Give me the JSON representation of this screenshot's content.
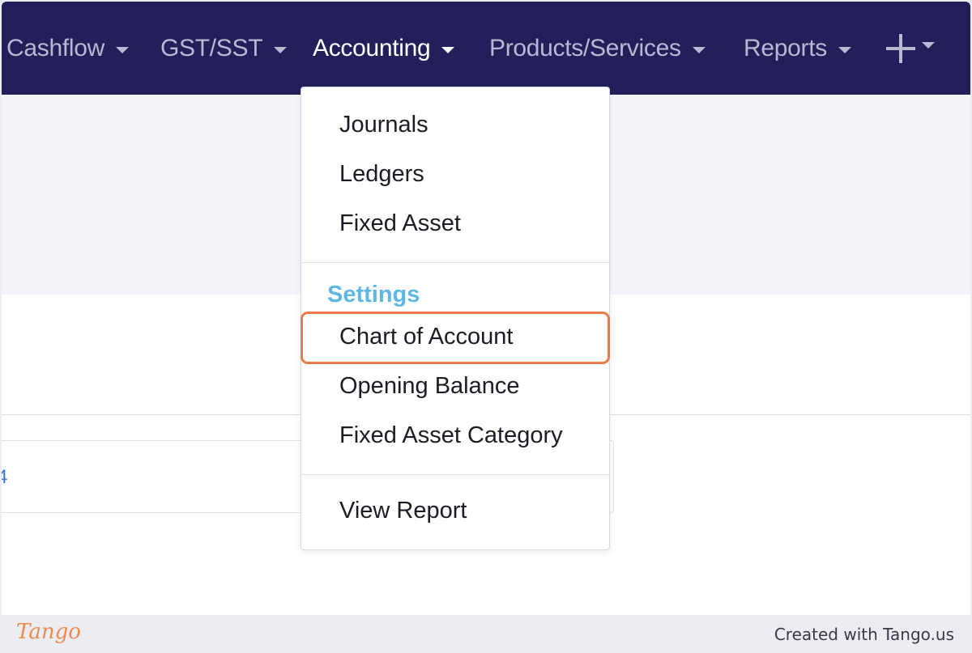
{
  "nav": {
    "items": [
      {
        "label": "Cashflow"
      },
      {
        "label": "GST/SST"
      },
      {
        "label": "Accounting"
      },
      {
        "label": "Products/Services"
      },
      {
        "label": "Reports"
      }
    ],
    "active": "Accounting"
  },
  "dropdown": {
    "group1": [
      "Journals",
      "Ledgers",
      "Fixed Asset"
    ],
    "settings_header": "Settings",
    "group2": [
      "Chart of Account",
      "Opening Balance",
      "Fixed Asset Category"
    ],
    "group3": [
      "View Report"
    ],
    "highlighted": "Chart of Account"
  },
  "footer": {
    "logo": "Tango",
    "credit": "Created with Tango.us"
  },
  "colors": {
    "navbar": "#221f5a",
    "highlight": "#ec7b45",
    "settings_header": "#5fb8e4"
  }
}
